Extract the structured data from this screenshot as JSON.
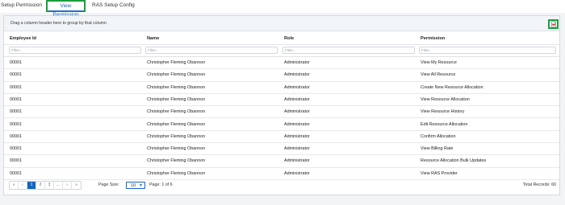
{
  "tabs": [
    {
      "label": "Setup Permission"
    },
    {
      "label": "View Permission"
    },
    {
      "label": "RAS Setup Config"
    }
  ],
  "grid": {
    "group_hint": "Drag a column header here to group by that column",
    "export_icon": "pdf-export-icon",
    "columns": [
      "Employee Id",
      "Name",
      "Role",
      "Permission"
    ],
    "filter_placeholder": "Filter...",
    "rows": [
      [
        "00001",
        "Christopher Fleming Obannon",
        "Administrator",
        "View My Resource"
      ],
      [
        "00001",
        "Christopher Fleming Obannon",
        "Administrator",
        "View All Resource"
      ],
      [
        "00001",
        "Christopher Fleming Obannon",
        "Administrator",
        "Create New Resource Allocation"
      ],
      [
        "00001",
        "Christopher Fleming Obannon",
        "Administrator",
        "View Resource Allocation"
      ],
      [
        "00001",
        "Christopher Fleming Obannon",
        "Administrator",
        "View Resource History"
      ],
      [
        "00001",
        "Christopher Fleming Obannon",
        "Administrator",
        "Edit Resource Allocation"
      ],
      [
        "00001",
        "Christopher Fleming Obannon",
        "Administrator",
        "Confirm Allocation"
      ],
      [
        "00001",
        "Christopher Fleming Obannon",
        "Administrator",
        "View Billing Rate"
      ],
      [
        "00001",
        "Christopher Fleming Obannon",
        "Administrator",
        "Resource Allocation Bulk Updates"
      ],
      [
        "00001",
        "Christopher Fleming Obannon",
        "Administrator",
        "View RAS Provider"
      ]
    ]
  },
  "pager": {
    "buttons": [
      "«",
      "‹",
      "1",
      "2",
      "3",
      "...",
      "›",
      "»"
    ],
    "page_size_label": "Page Size:",
    "page_size_value": "10",
    "page_info": "Page: 1 of 6",
    "total": "Total Records: 60"
  },
  "colors": {
    "accent": "#1565c0",
    "highlight": "#1b9e3e"
  }
}
